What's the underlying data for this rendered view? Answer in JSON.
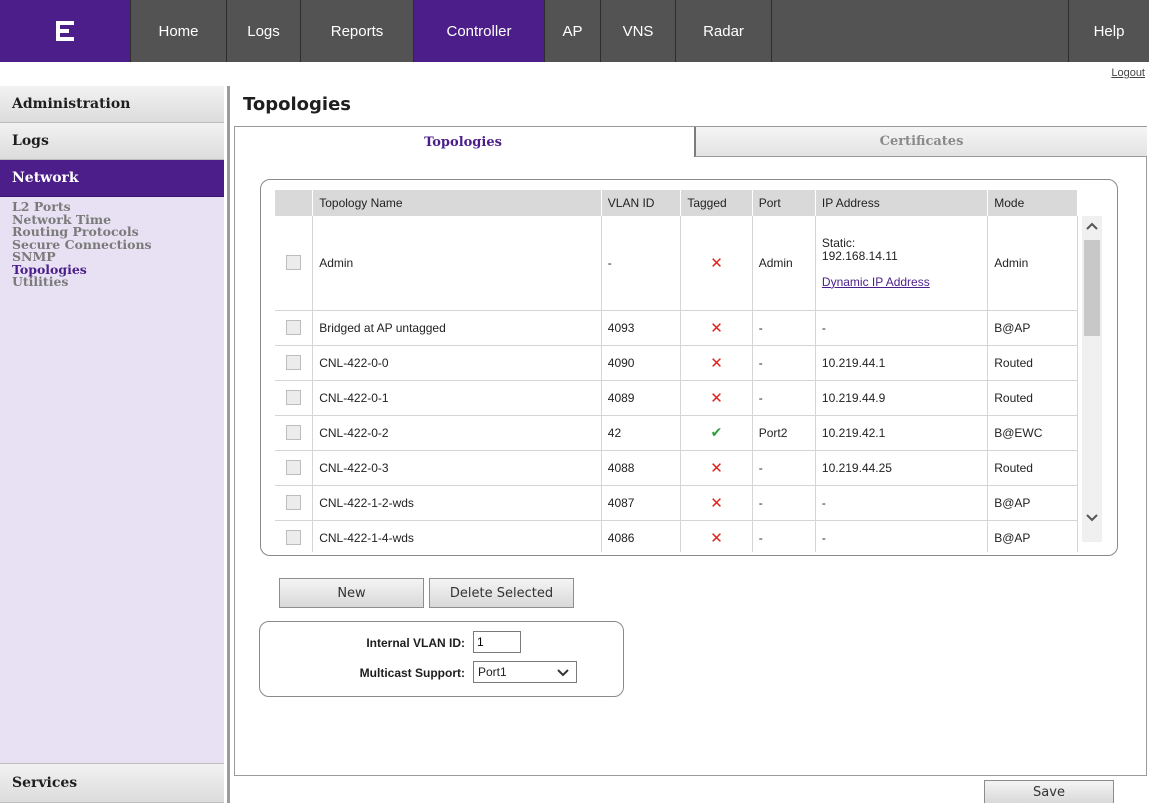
{
  "nav": {
    "tabs": [
      {
        "label": "Home",
        "active": false
      },
      {
        "label": "Logs",
        "active": false
      },
      {
        "label": "Reports",
        "active": false
      },
      {
        "label": "Controller",
        "active": true
      },
      {
        "label": "AP",
        "active": false
      },
      {
        "label": "VNS",
        "active": false
      },
      {
        "label": "Radar",
        "active": false
      }
    ],
    "help": "Help",
    "logout": "Logout",
    "logo_icon": "extreme-networks-logo-icon"
  },
  "sidebar": {
    "sections": {
      "administration": "Administration",
      "logs": "Logs",
      "network": "Network",
      "services": "Services"
    },
    "items": [
      {
        "label": "L2 Ports",
        "active": false
      },
      {
        "label": "Network Time",
        "active": false
      },
      {
        "label": "Routing Protocols",
        "active": false
      },
      {
        "label": "Secure Connections",
        "active": false
      },
      {
        "label": "SNMP",
        "active": false
      },
      {
        "label": "Topologies",
        "active": true
      },
      {
        "label": "Utilities",
        "active": false
      }
    ]
  },
  "main": {
    "title": "Topologies",
    "tabs": [
      {
        "label": "Topologies",
        "active": true
      },
      {
        "label": "Certificates",
        "active": false
      }
    ],
    "table": {
      "columns": [
        "Topology Name",
        "VLAN ID",
        "Tagged",
        "Port",
        "IP Address",
        "Mode"
      ],
      "rows": [
        {
          "name": "Admin",
          "vlan": "-",
          "tagged": false,
          "port": "Admin",
          "ip_static_label": "Static:",
          "ip": "192.168.14.11",
          "ip_link": "Dynamic IP Address",
          "mode": "Admin"
        },
        {
          "name": "Bridged at AP untagged",
          "vlan": "4093",
          "tagged": false,
          "port": "-",
          "ip": "-",
          "mode": "B@AP"
        },
        {
          "name": "CNL-422-0-0",
          "vlan": "4090",
          "tagged": false,
          "port": "-",
          "ip": "10.219.44.1",
          "mode": "Routed"
        },
        {
          "name": "CNL-422-0-1",
          "vlan": "4089",
          "tagged": false,
          "port": "-",
          "ip": "10.219.44.9",
          "mode": "Routed"
        },
        {
          "name": "CNL-422-0-2",
          "vlan": "42",
          "tagged": true,
          "port": "Port2",
          "ip": "10.219.42.1",
          "mode": "B@EWC"
        },
        {
          "name": "CNL-422-0-3",
          "vlan": "4088",
          "tagged": false,
          "port": "-",
          "ip": "10.219.44.25",
          "mode": "Routed"
        },
        {
          "name": "CNL-422-1-2-wds",
          "vlan": "4087",
          "tagged": false,
          "port": "-",
          "ip": "-",
          "mode": "B@AP"
        },
        {
          "name": "CNL-422-1-4-wds",
          "vlan": "4086",
          "tagged": false,
          "port": "-",
          "ip": "-",
          "mode": "B@AP"
        }
      ],
      "tagged_true_glyph": "✔",
      "tagged_false_glyph": "✕"
    },
    "buttons": {
      "new": "New",
      "delete_selected": "Delete Selected",
      "save": "Save"
    },
    "settings": {
      "internal_vlan_label": "Internal VLAN ID:",
      "internal_vlan_value": "1",
      "multicast_label": "Multicast Support:",
      "multicast_value": "Port1"
    }
  },
  "colors": {
    "brand_purple": "#4b1e8a",
    "nav_gray": "#535353",
    "sidebar_bg": "#e8e1f3",
    "error_red": "#e2231a",
    "ok_green": "#2e9e3a"
  }
}
